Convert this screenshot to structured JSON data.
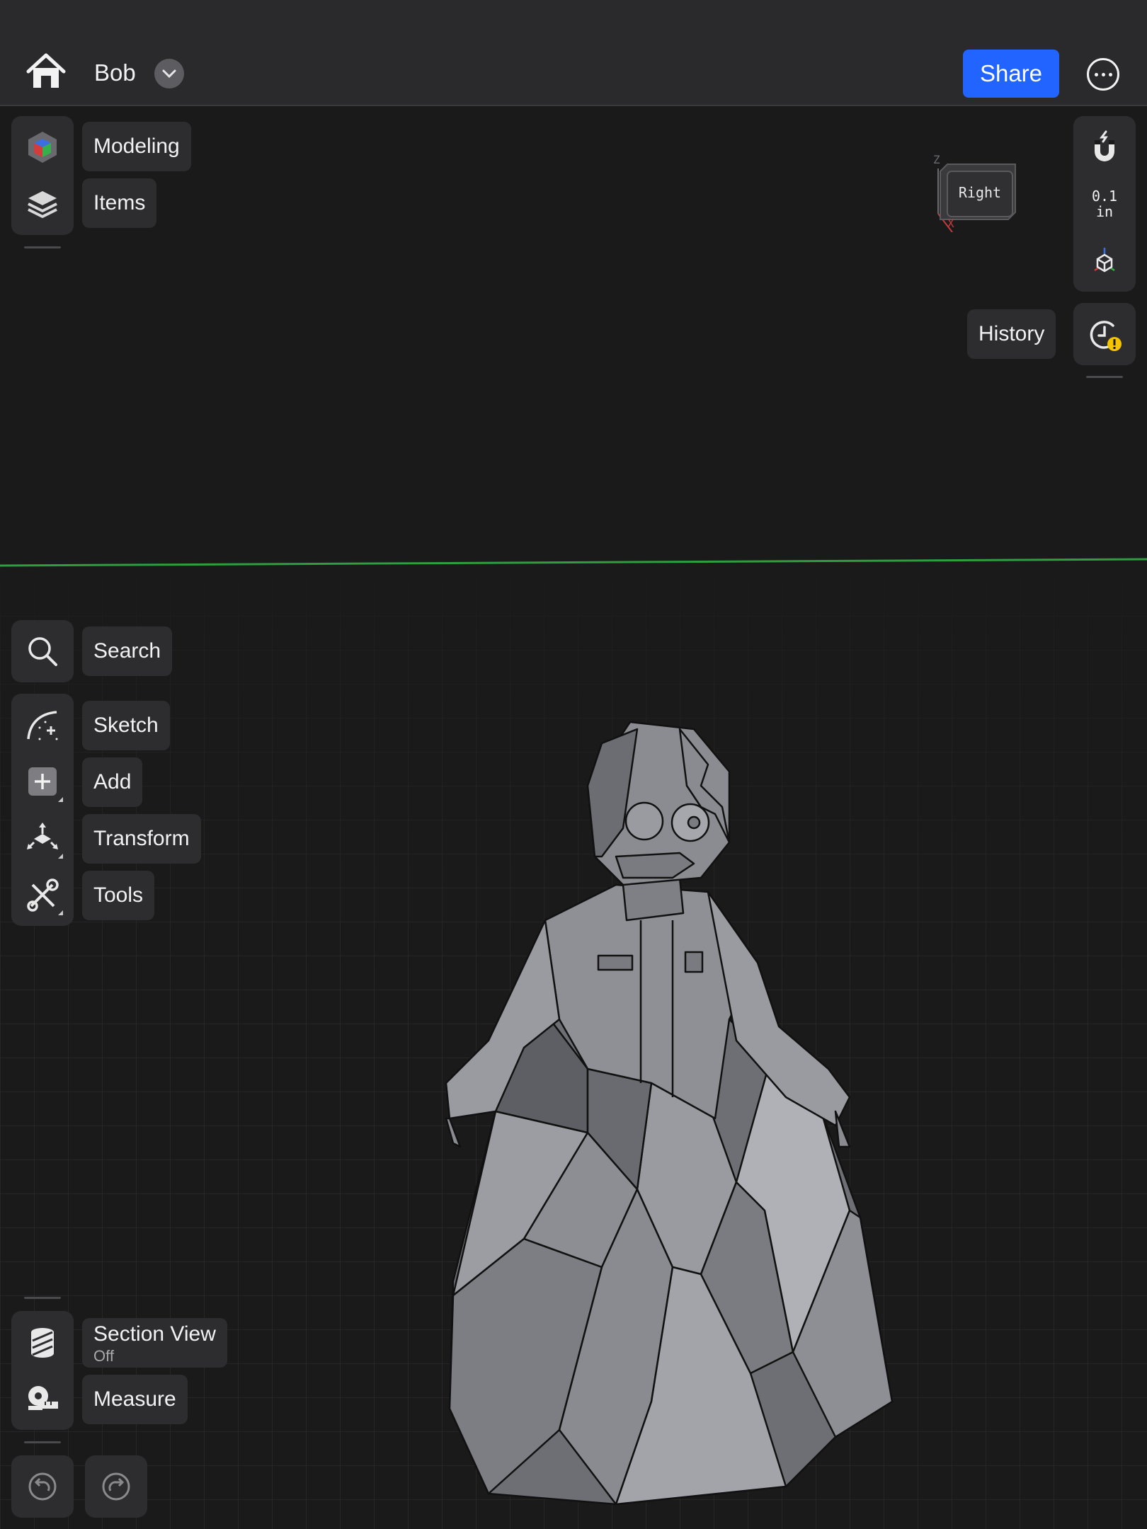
{
  "header": {
    "document_title": "Bob",
    "share_label": "Share"
  },
  "left_top_panel": {
    "items": [
      {
        "label": "Modeling",
        "icon": "modeling-cube-icon"
      },
      {
        "label": "Items",
        "icon": "layers-icon"
      }
    ]
  },
  "left_tools": {
    "search_label": "Search",
    "items": [
      {
        "label": "Sketch",
        "icon": "sketch-icon"
      },
      {
        "label": "Add",
        "icon": "add-icon"
      },
      {
        "label": "Transform",
        "icon": "transform-icon"
      },
      {
        "label": "Tools",
        "icon": "tools-icon"
      }
    ]
  },
  "left_bottom": {
    "section_view_label": "Section View",
    "section_view_state": "Off",
    "measure_label": "Measure"
  },
  "view_cube": {
    "face_label": "Right",
    "axis_z": "Z",
    "axis_x": "X"
  },
  "right_panel": {
    "grid_step": "0.1",
    "grid_unit": "in",
    "history_label": "History"
  },
  "colors": {
    "accent": "#2264ff",
    "warning": "#f5c400",
    "horizon": "#2f9e3f"
  }
}
